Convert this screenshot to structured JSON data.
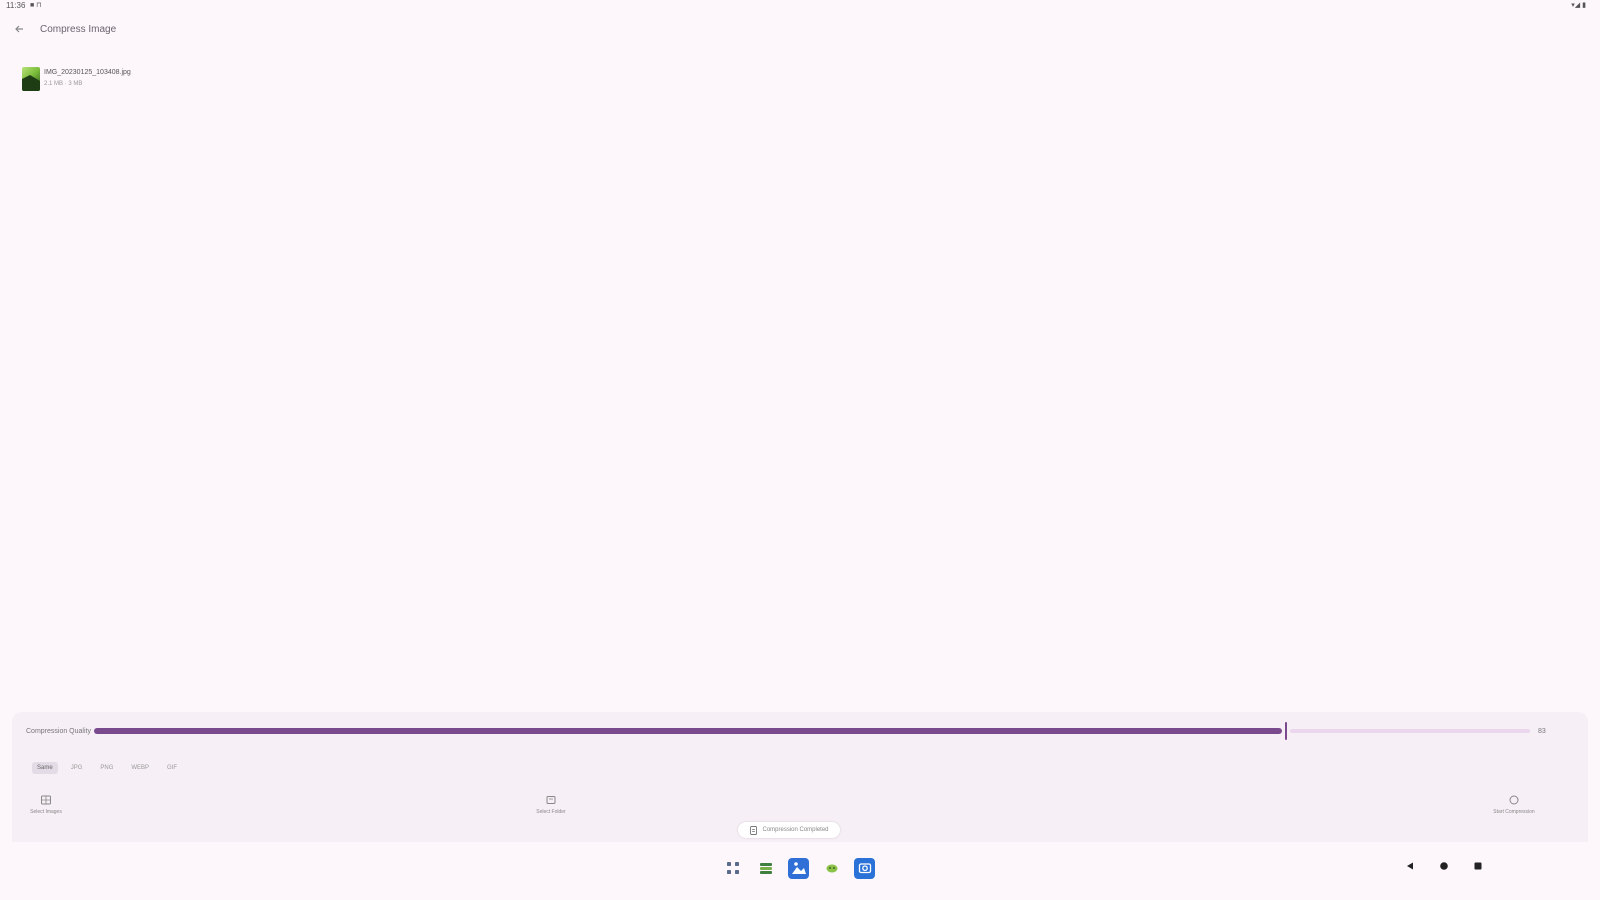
{
  "status_bar": {
    "time": "11:36",
    "left_icons": "■ ⊓",
    "right_icons": "▾◢ ▮"
  },
  "app_bar": {
    "back_icon": "arrow-back-icon",
    "title": "Compress Image"
  },
  "files": [
    {
      "name": "IMG_20230125_103408.jpg",
      "meta": "2.1 MB · 3 MB"
    }
  ],
  "compression": {
    "label": "Compression Quality",
    "value": 83,
    "value_label": "83"
  },
  "format_chips": [
    {
      "label": "Same",
      "selected": true
    },
    {
      "label": "JPG",
      "selected": false
    },
    {
      "label": "PNG",
      "selected": false
    },
    {
      "label": "WEBP",
      "selected": false
    },
    {
      "label": "GIF",
      "selected": false
    }
  ],
  "actions": {
    "left_label": "Select Images",
    "center_label": "Select Folder",
    "right_label": "Start Compression"
  },
  "pill": {
    "label": "Compression Completed"
  },
  "dock": [
    "app-drawer-icon",
    "files-icon",
    "photos-icon",
    "android-icon",
    "camera-icon"
  ],
  "colors": {
    "background": "#fdf7fb",
    "accent": "#7a4a8e",
    "accent_light": "#ead7ee",
    "panel": "#f6eff5"
  }
}
